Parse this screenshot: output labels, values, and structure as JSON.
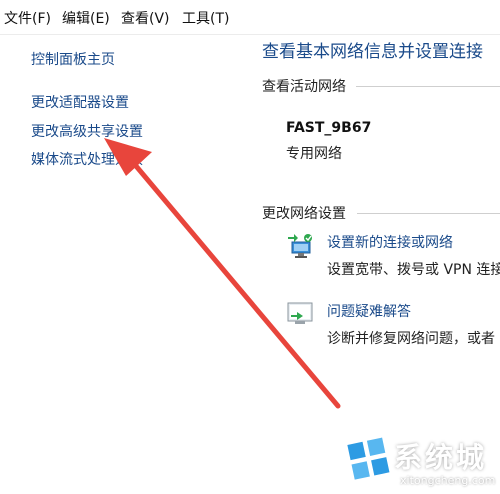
{
  "menubar": {
    "items": [
      {
        "label": "文件(F)"
      },
      {
        "label": "编辑(E)"
      },
      {
        "label": "查看(V)"
      },
      {
        "label": "工具(T)"
      }
    ]
  },
  "left_panel": {
    "home_link": "控制面板主页",
    "links": [
      {
        "label": "更改适配器设置"
      },
      {
        "label": "更改高级共享设置"
      },
      {
        "label": "媒体流式处理选项"
      }
    ]
  },
  "main": {
    "title": "查看基本网络信息并设置连接",
    "active_networks_label": "查看活动网络",
    "network": {
      "name": "FAST_9B67",
      "type": "专用网络"
    },
    "change_settings_label": "更改网络设置",
    "tasks": [
      {
        "link": "设置新的连接或网络",
        "desc": "设置宽带、拨号或 VPN 连接",
        "icon": "network-setup-icon"
      },
      {
        "link": "问题疑难解答",
        "desc": "诊断并修复网络问题，或者",
        "icon": "troubleshoot-icon"
      }
    ]
  },
  "annotation": {
    "arrow_color": "#e8453c",
    "icon": "red-arrow-icon"
  },
  "watermark": {
    "text": "系统城",
    "url": "xitongcheng.com",
    "icon": "windows-logo-icon"
  }
}
